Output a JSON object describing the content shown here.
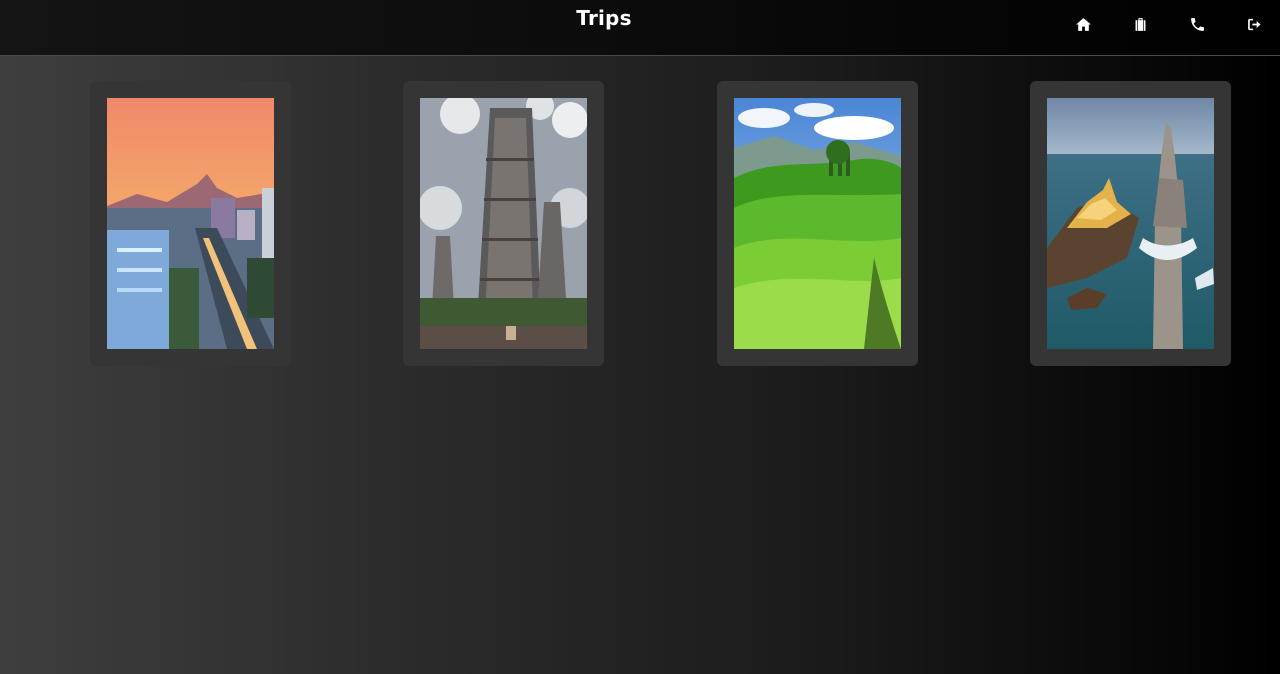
{
  "header": {
    "title": "Trips",
    "nav": [
      {
        "icon": "home-icon"
      },
      {
        "icon": "suitcase-icon"
      },
      {
        "icon": "phone-icon"
      },
      {
        "icon": "logout-icon"
      }
    ]
  },
  "trips": [
    {
      "image": "city-sunset-photo"
    },
    {
      "image": "temple-tower-photo"
    },
    {
      "image": "tea-hills-photo"
    },
    {
      "image": "coastal-statue-photo"
    }
  ],
  "colors": {
    "header_bg": "#0b0b0b",
    "card_bg": "#353535",
    "text": "#ffffff"
  }
}
